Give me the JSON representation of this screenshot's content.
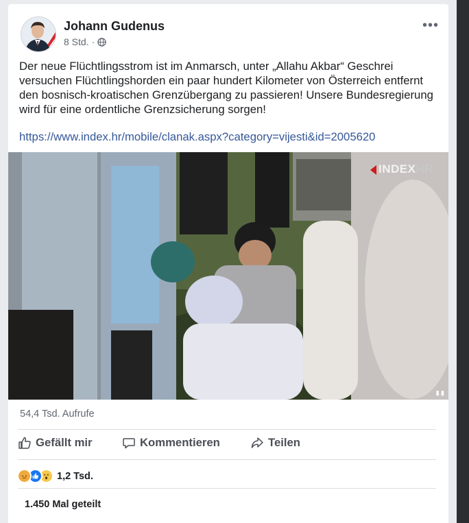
{
  "post": {
    "author": "Johann Gudenus",
    "time": "8 Std.",
    "privacy_icon": "globe-icon",
    "text": "Der neue Flüchtlingsstrom ist im Anmarsch, unter „Allahu Akbar“ Geschrei versuchen Flüchtlingshorden ein paar hundert Kilometer von Österreich entfernt den bosnisch-kroatischen Grenzübergang zu passieren! Unsere Bundesregierung wird für eine ordentliche Grenzsicherung sorgen!",
    "link": "https://www.index.hr/mobile/clanak.aspx?category=vijesti&id=2005620"
  },
  "video": {
    "watermark": "INDEX",
    "watermark_suffix": "HR"
  },
  "stats": {
    "views": "54,4 Tsd. Aufrufe",
    "reactions_count": "1,2 Tsd.",
    "shares": "1.450 Mal geteilt"
  },
  "actions": {
    "like": "Gefällt mir",
    "comment": "Kommentieren",
    "share": "Teilen"
  },
  "colors": {
    "link": "#365899",
    "angry": "#f0aa3c",
    "like": "#1877f2",
    "wow": "#f7c94b"
  }
}
